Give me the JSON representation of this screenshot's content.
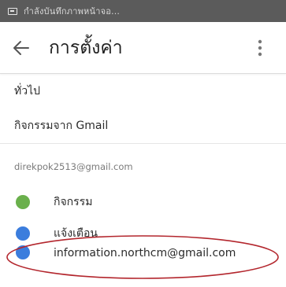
{
  "status_bar": {
    "text": "กำลังบันทึกภาพหน้าจอ..."
  },
  "app_bar": {
    "title": "การตั้งค่า"
  },
  "settings": {
    "general_label": "ทั่วไป",
    "gmail_activity_label": "กิจกรรมจาก Gmail"
  },
  "account_section": {
    "email": "direkpok2513@gmail.com",
    "items": [
      {
        "label": "กิจกรรม",
        "dot_color": "#6ab04c"
      },
      {
        "label": "แจ้งเตือน",
        "dot_color": "#3b7ddd"
      },
      {
        "label": "information.northcm@gmail.com",
        "dot_color": "#3b7ddd"
      }
    ]
  },
  "colors": {
    "status_bar_bg": "#5b5b5b",
    "highlight_oval": "#b3262d"
  }
}
